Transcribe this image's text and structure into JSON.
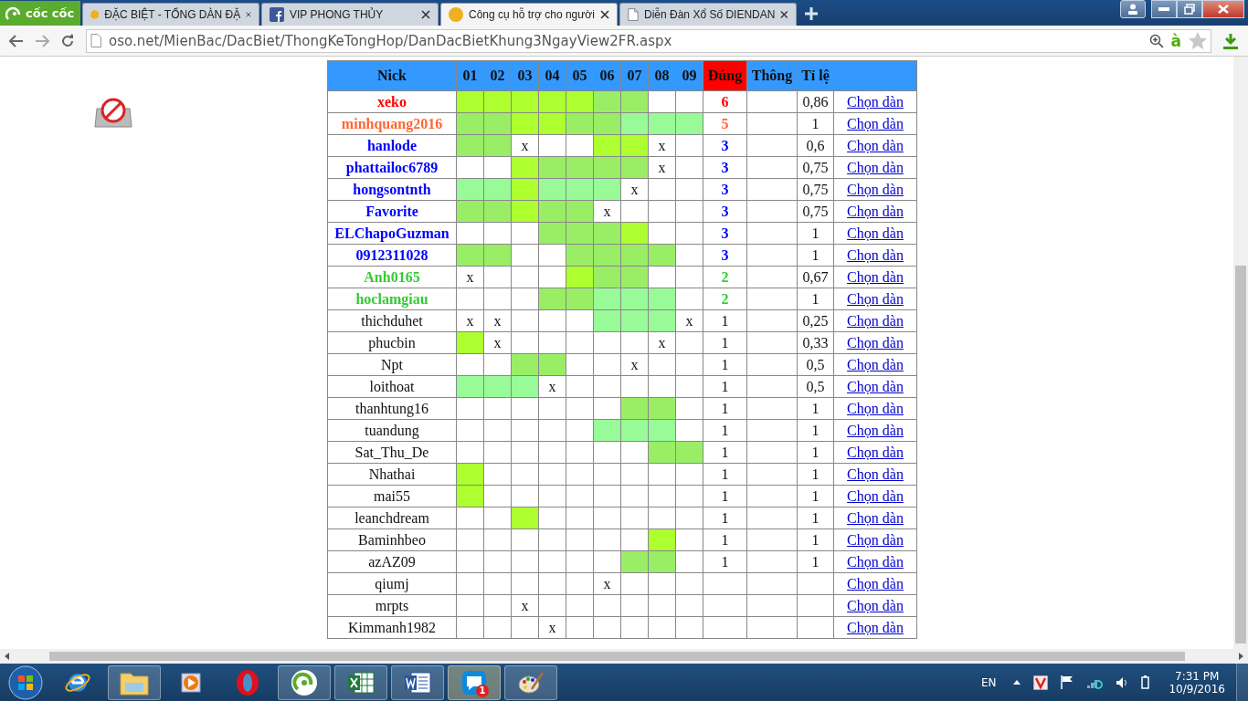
{
  "browser": {
    "logo": "cốc cốc",
    "tabs": [
      {
        "title": "ĐẶC BIỆT - TỔNG DÀN ĐẶ",
        "selected": false
      },
      {
        "title": "VIP PHONG THỦY",
        "selected": false
      },
      {
        "title": "Công cụ hỗ trợ cho người",
        "selected": true
      },
      {
        "title": "Diễn Đàn Xổ Số DIENDAN",
        "selected": false
      }
    ],
    "url": "oso.net/MienBac/DacBiet/ThongKeTongHop/DanDacBietKhung3NgayView2FR.aspx",
    "input_method": "à"
  },
  "table": {
    "columns": [
      {
        "label": "Nick",
        "highlighted": false
      },
      {
        "label": "01",
        "highlighted": false
      },
      {
        "label": "02",
        "highlighted": false
      },
      {
        "label": "03",
        "highlighted": false
      },
      {
        "label": "04",
        "highlighted": false
      },
      {
        "label": "05",
        "highlighted": false
      },
      {
        "label": "06",
        "highlighted": false
      },
      {
        "label": "07",
        "highlighted": false
      },
      {
        "label": "08",
        "highlighted": false
      },
      {
        "label": "09",
        "highlighted": false
      },
      {
        "label": "Đúng",
        "highlighted": true
      },
      {
        "label": "Thông",
        "highlighted": false
      },
      {
        "label": "Tỉ lệ",
        "highlighted": false
      }
    ],
    "rows": [
      {
        "highlighted": true,
        "color": "#ff0000",
        "cells": [
          "xeko",
          {
            "color": "#adff2f"
          },
          {
            "color": "#adff2f"
          },
          {
            "color": "#adff2f"
          },
          {
            "color": "#adff2f"
          },
          {
            "color": "#adff2f"
          },
          {
            "color": "#99ee66"
          },
          {
            "color": "#99ee66"
          },
          null,
          null,
          "6",
          null,
          "0,86"
        ],
        "link": "Chọn dàn"
      },
      {
        "highlighted": true,
        "color": "#ff6633",
        "cells": [
          "minhquang2016",
          {
            "color": "#99ee66"
          },
          {
            "color": "#99ee66"
          },
          {
            "color": "#adff2f"
          },
          {
            "color": "#adff2f"
          },
          {
            "color": "#99ee66"
          },
          {
            "color": "#99ee66"
          },
          {
            "color": "#98fb98"
          },
          {
            "color": "#98fb98"
          },
          {
            "color": "#98fb98"
          },
          "5",
          null,
          "1"
        ],
        "link": "Chọn dàn"
      },
      {
        "highlighted": true,
        "color": "#0000ff",
        "cells": [
          "hanlode",
          {
            "color": "#99ee66"
          },
          {
            "color": "#99ee66"
          },
          "x",
          null,
          null,
          {
            "color": "#adff2f"
          },
          {
            "color": "#adff2f"
          },
          "x",
          null,
          "3",
          null,
          "0,6"
        ],
        "link": "Chọn dàn"
      },
      {
        "highlighted": true,
        "color": "#0000ff",
        "cells": [
          "phattailoc6789",
          null,
          null,
          {
            "color": "#adff2f"
          },
          {
            "color": "#99ee66"
          },
          {
            "color": "#99ee66"
          },
          {
            "color": "#99ee66"
          },
          {
            "color": "#99ee66"
          },
          "x",
          null,
          "3",
          null,
          "0,75"
        ],
        "link": "Chọn dàn"
      },
      {
        "highlighted": true,
        "color": "#0000ff",
        "cells": [
          "hongsontnth",
          {
            "color": "#98fb98"
          },
          {
            "color": "#98fb98"
          },
          {
            "color": "#adff2f"
          },
          {
            "color": "#98fb98"
          },
          {
            "color": "#98fb98"
          },
          {
            "color": "#98fb98"
          },
          "x",
          null,
          null,
          "3",
          null,
          "0,75"
        ],
        "link": "Chọn dàn"
      },
      {
        "highlighted": true,
        "color": "#0000ff",
        "cells": [
          "Favorite",
          {
            "color": "#99ee66"
          },
          {
            "color": "#99ee66"
          },
          {
            "color": "#adff2f"
          },
          {
            "color": "#99ee66"
          },
          {
            "color": "#99ee66"
          },
          "x",
          null,
          null,
          null,
          "3",
          null,
          "0,75"
        ],
        "link": "Chọn dàn"
      },
      {
        "highlighted": true,
        "color": "#0000ff",
        "cells": [
          "ELChapoGuzman",
          null,
          null,
          null,
          {
            "color": "#99ee66"
          },
          {
            "color": "#99ee66"
          },
          {
            "color": "#99ee66"
          },
          {
            "color": "#adff2f"
          },
          null,
          null,
          "3",
          null,
          "1"
        ],
        "link": "Chọn dàn"
      },
      {
        "highlighted": true,
        "color": "#0000ff",
        "cells": [
          "0912311028",
          {
            "color": "#99ee66"
          },
          {
            "color": "#99ee66"
          },
          null,
          null,
          {
            "color": "#99ee66"
          },
          {
            "color": "#99ee66"
          },
          {
            "color": "#99ee66"
          },
          {
            "color": "#99ee66"
          },
          null,
          "3",
          null,
          "1"
        ],
        "link": "Chọn dàn"
      },
      {
        "highlighted": true,
        "color": "#33cc33",
        "cells": [
          "Anh0165",
          "x",
          null,
          null,
          null,
          {
            "color": "#adff2f"
          },
          {
            "color": "#99ee66"
          },
          {
            "color": "#99ee66"
          },
          null,
          null,
          "2",
          null,
          "0,67"
        ],
        "link": "Chọn dàn"
      },
      {
        "highlighted": true,
        "color": "#33cc33",
        "cells": [
          "hoclamgiau",
          null,
          null,
          null,
          {
            "color": "#99ee66"
          },
          {
            "color": "#99ee66"
          },
          {
            "color": "#98fb98"
          },
          {
            "color": "#98fb98"
          },
          {
            "color": "#98fb98"
          },
          null,
          "2",
          null,
          "1"
        ],
        "link": "Chọn dàn"
      },
      {
        "highlighted": false,
        "cells": [
          "thichduhet",
          "x",
          "x",
          null,
          null,
          null,
          {
            "color": "#98fb98"
          },
          {
            "color": "#98fb98"
          },
          {
            "color": "#98fb98"
          },
          "x",
          "1",
          null,
          "0,25"
        ],
        "link": "Chọn dàn"
      },
      {
        "highlighted": false,
        "cells": [
          "phucbin",
          {
            "color": "#adff2f"
          },
          "x",
          null,
          null,
          null,
          null,
          null,
          "x",
          null,
          "1",
          null,
          "0,33"
        ],
        "link": "Chọn dàn"
      },
      {
        "highlighted": false,
        "cells": [
          "Npt",
          null,
          null,
          {
            "color": "#99ee66"
          },
          {
            "color": "#99ee66"
          },
          null,
          null,
          "x",
          null,
          null,
          "1",
          null,
          "0,5"
        ],
        "link": "Chọn dàn"
      },
      {
        "highlighted": false,
        "cells": [
          "loithoat",
          {
            "color": "#98fb98"
          },
          {
            "color": "#98fb98"
          },
          {
            "color": "#98fb98"
          },
          "x",
          null,
          null,
          null,
          null,
          null,
          "1",
          null,
          "0,5"
        ],
        "link": "Chọn dàn"
      },
      {
        "highlighted": false,
        "cells": [
          "thanhtung16",
          null,
          null,
          null,
          null,
          null,
          null,
          {
            "color": "#99ee66"
          },
          {
            "color": "#99ee66"
          },
          null,
          "1",
          null,
          "1"
        ],
        "link": "Chọn dàn"
      },
      {
        "highlighted": false,
        "cells": [
          "tuandung",
          null,
          null,
          null,
          null,
          null,
          {
            "color": "#98fb98"
          },
          {
            "color": "#98fb98"
          },
          {
            "color": "#98fb98"
          },
          null,
          "1",
          null,
          "1"
        ],
        "link": "Chọn dàn"
      },
      {
        "highlighted": false,
        "cells": [
          "Sat_Thu_De",
          null,
          null,
          null,
          null,
          null,
          null,
          null,
          {
            "color": "#99ee66"
          },
          {
            "color": "#99ee66"
          },
          "1",
          null,
          "1"
        ],
        "link": "Chọn dàn"
      },
      {
        "highlighted": false,
        "cells": [
          "Nhathai",
          {
            "color": "#adff2f"
          },
          null,
          null,
          null,
          null,
          null,
          null,
          null,
          null,
          "1",
          null,
          "1"
        ],
        "link": "Chọn dàn"
      },
      {
        "highlighted": false,
        "cells": [
          "mai55",
          {
            "color": "#adff2f"
          },
          null,
          null,
          null,
          null,
          null,
          null,
          null,
          null,
          "1",
          null,
          "1"
        ],
        "link": "Chọn dàn"
      },
      {
        "highlighted": false,
        "cells": [
          "leanchdream",
          null,
          null,
          {
            "color": "#adff2f"
          },
          null,
          null,
          null,
          null,
          null,
          null,
          "1",
          null,
          "1"
        ],
        "link": "Chọn dàn"
      },
      {
        "highlighted": false,
        "cells": [
          "Baminhbeo",
          null,
          null,
          null,
          null,
          null,
          null,
          null,
          {
            "color": "#adff2f"
          },
          null,
          "1",
          null,
          "1"
        ],
        "link": "Chọn dàn"
      },
      {
        "highlighted": false,
        "cells": [
          "azAZ09",
          null,
          null,
          null,
          null,
          null,
          null,
          {
            "color": "#99ee66"
          },
          {
            "color": "#99ee66"
          },
          null,
          "1",
          null,
          "1"
        ],
        "link": "Chọn dàn"
      },
      {
        "highlighted": false,
        "cells": [
          "qiumj",
          null,
          null,
          null,
          null,
          null,
          "x",
          null,
          null,
          null,
          null,
          null,
          null
        ],
        "link": "Chọn dàn"
      },
      {
        "highlighted": false,
        "cells": [
          "mrpts",
          null,
          null,
          "x",
          null,
          null,
          null,
          null,
          null,
          null,
          null,
          null,
          null
        ],
        "link": "Chọn dàn"
      },
      {
        "highlighted": false,
        "cells": [
          "Kimmanh1982",
          null,
          null,
          null,
          "x",
          null,
          null,
          null,
          null,
          null,
          null,
          null,
          null
        ],
        "link": "Chọn dàn"
      }
    ]
  },
  "taskbar": {
    "zalo_badge": "1",
    "language": "EN",
    "time": "7:31 PM",
    "date": "10/9/2016"
  }
}
